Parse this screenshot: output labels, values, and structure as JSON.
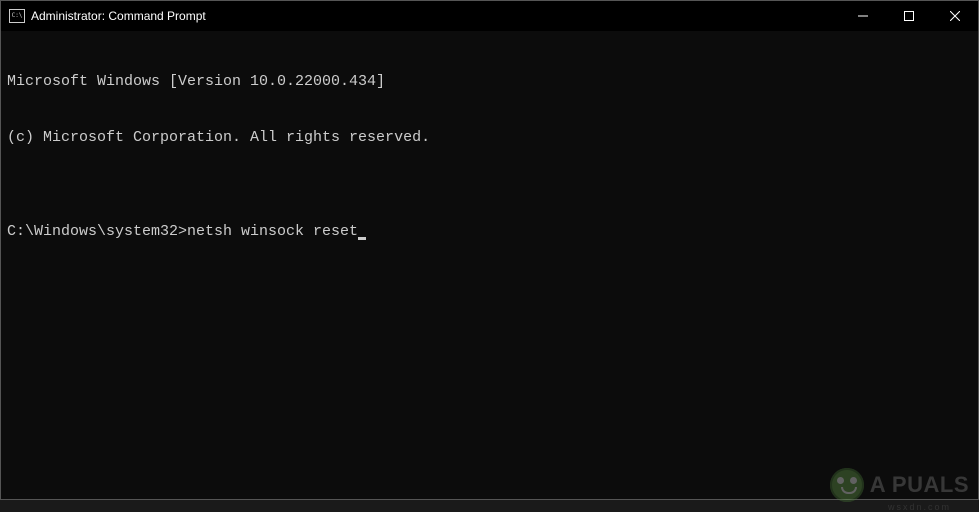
{
  "titlebar": {
    "icon_label": "C:\\",
    "title": "Administrator: Command Prompt"
  },
  "terminal": {
    "line1": "Microsoft Windows [Version 10.0.22000.434]",
    "line2": "(c) Microsoft Corporation. All rights reserved.",
    "blank": "",
    "prompt": "C:\\Windows\\system32>",
    "command": "netsh winsock reset"
  },
  "watermark": {
    "brand": "A  PUALS",
    "sub": "wsxdn.com"
  }
}
